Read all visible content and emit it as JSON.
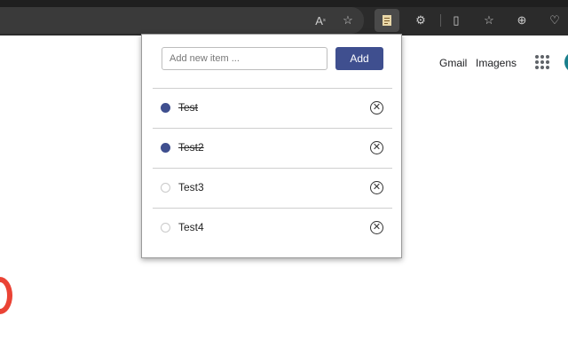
{
  "popup": {
    "input_placeholder": "Add new item ...",
    "add_label": "Add",
    "items": [
      {
        "text": "Test",
        "done": true
      },
      {
        "text": "Test2",
        "done": true
      },
      {
        "text": "Test3",
        "done": false
      },
      {
        "text": "Test4",
        "done": false
      }
    ]
  },
  "google": {
    "gmail": "Gmail",
    "images": "Imagens"
  },
  "colors": {
    "accent": "#3f4f8f",
    "chrome": "#2b2b2b"
  },
  "icons": [
    "read-aloud-icon",
    "favorite-star-icon",
    "extension-todo-icon",
    "extensions-puzzle-icon",
    "split-screen-icon",
    "favorites-list-icon",
    "collections-icon",
    "browser-essentials-icon",
    "delete-icon",
    "apps-grid-icon"
  ]
}
